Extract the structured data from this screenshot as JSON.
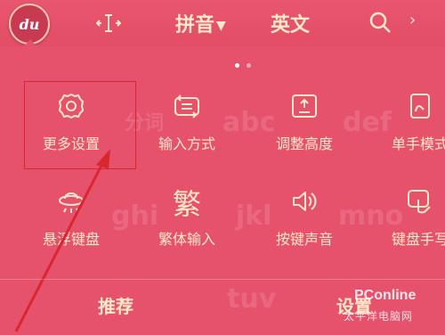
{
  "topbar": {
    "logo_text": "du",
    "tab_pinyin": "拼音",
    "tab_english": "英文",
    "icons": [
      "cursor-move-icon",
      "search-icon",
      "chevron-right-icon"
    ]
  },
  "pager": {
    "pages": 2,
    "active": 1
  },
  "grid": {
    "items": [
      {
        "label": "更多设置",
        "icon": "gear-icon"
      },
      {
        "label": "输入方式",
        "icon": "switch-keyboard-icon"
      },
      {
        "label": "调整高度",
        "icon": "resize-height-icon"
      },
      {
        "label": "单手模式",
        "icon": "one-hand-icon"
      },
      {
        "label": "悬浮键盘",
        "icon": "floating-keyboard-icon"
      },
      {
        "label": "繁体输入",
        "icon": "traditional-char-icon",
        "glyph": "繁"
      },
      {
        "label": "按键声音",
        "icon": "speaker-icon"
      },
      {
        "label": "键盘手写",
        "icon": "handwriting-icon"
      }
    ]
  },
  "background_keys": [
    "分词",
    "abc",
    "def",
    "ghi",
    "jkl",
    "mno",
    "tuv"
  ],
  "bottombar": {
    "recommend": "推荐",
    "settings": "设置"
  },
  "watermark": {
    "text": "PConline",
    "sub": "太平洋电脑网"
  },
  "colors": {
    "bg": "#e6526c",
    "text": "#fde8c8",
    "annotation": "#d9262f"
  }
}
